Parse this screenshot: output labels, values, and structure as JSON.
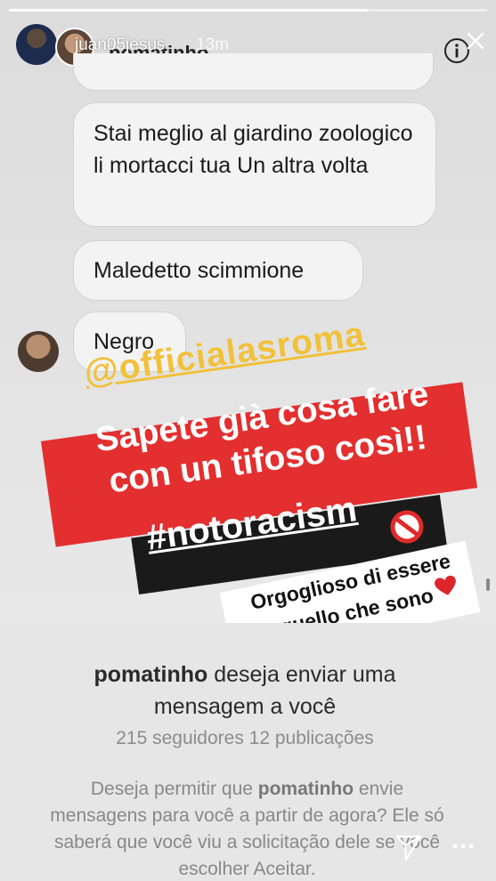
{
  "story": {
    "progress": 0.75,
    "username": "juan05jesus",
    "time_ago": "13m"
  },
  "chat": {
    "contact_name": "pomatinho",
    "messages": [
      {
        "text": "Stai meglio al giardino zoologico li mortacci tua Un altra volta"
      },
      {
        "text": "Maledetto scimmione"
      },
      {
        "text": "Negro"
      }
    ]
  },
  "overlay": {
    "mention": "@officialasroma",
    "red_line1": "Sapete già cosa fare",
    "red_line2": "con un tifoso così!!",
    "hashtag": "#notoracism",
    "proud_line1": "Orgoglioso di essere",
    "proud_line2": "quello che sono"
  },
  "request": {
    "username": "pomatinho",
    "title_rest_1": " deseja enviar uma",
    "title_rest_2": "mensagem a você",
    "stats": "215 seguidores 12 publicações",
    "body_pre": "Deseja permitir que ",
    "body_user": "pomatinho",
    "body_post": " envie mensagens para você a partir de agora? Ele só saberá que você viu a solicitação dele se você escolher Aceitar."
  },
  "colors": {
    "red_banner": "#e32f2f",
    "mention_yellow": "#f2c13b",
    "heart_red": "#e0242c"
  },
  "icons": [
    "info-icon",
    "close-icon",
    "no-entry-icon",
    "heart-icon",
    "send-icon",
    "more-icon"
  ]
}
